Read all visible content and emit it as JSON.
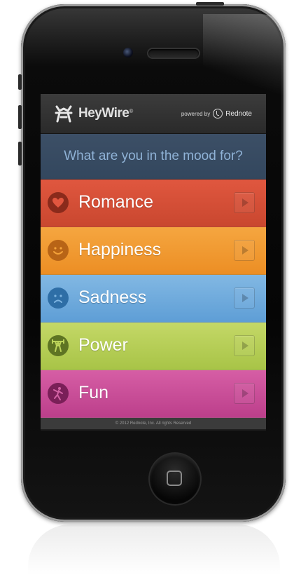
{
  "header": {
    "app_name": "HeyWire",
    "trademark": "®",
    "powered_by": "powered by",
    "partner": "Rednote"
  },
  "prompt": "What are you in the mood for?",
  "moods": [
    {
      "label": "Romance",
      "icon": "heart-icon",
      "color": "#d2503a"
    },
    {
      "label": "Happiness",
      "icon": "smiley-icon",
      "color": "#f29a33"
    },
    {
      "label": "Sadness",
      "icon": "sad-face-icon",
      "color": "#70abdd"
    },
    {
      "label": "Power",
      "icon": "weightlifter-icon",
      "color": "#b6ce57"
    },
    {
      "label": "Fun",
      "icon": "dancer-icon",
      "color": "#c94f98"
    }
  ],
  "footer": "© 2012 Rednote, Inc. All rights Reserved"
}
